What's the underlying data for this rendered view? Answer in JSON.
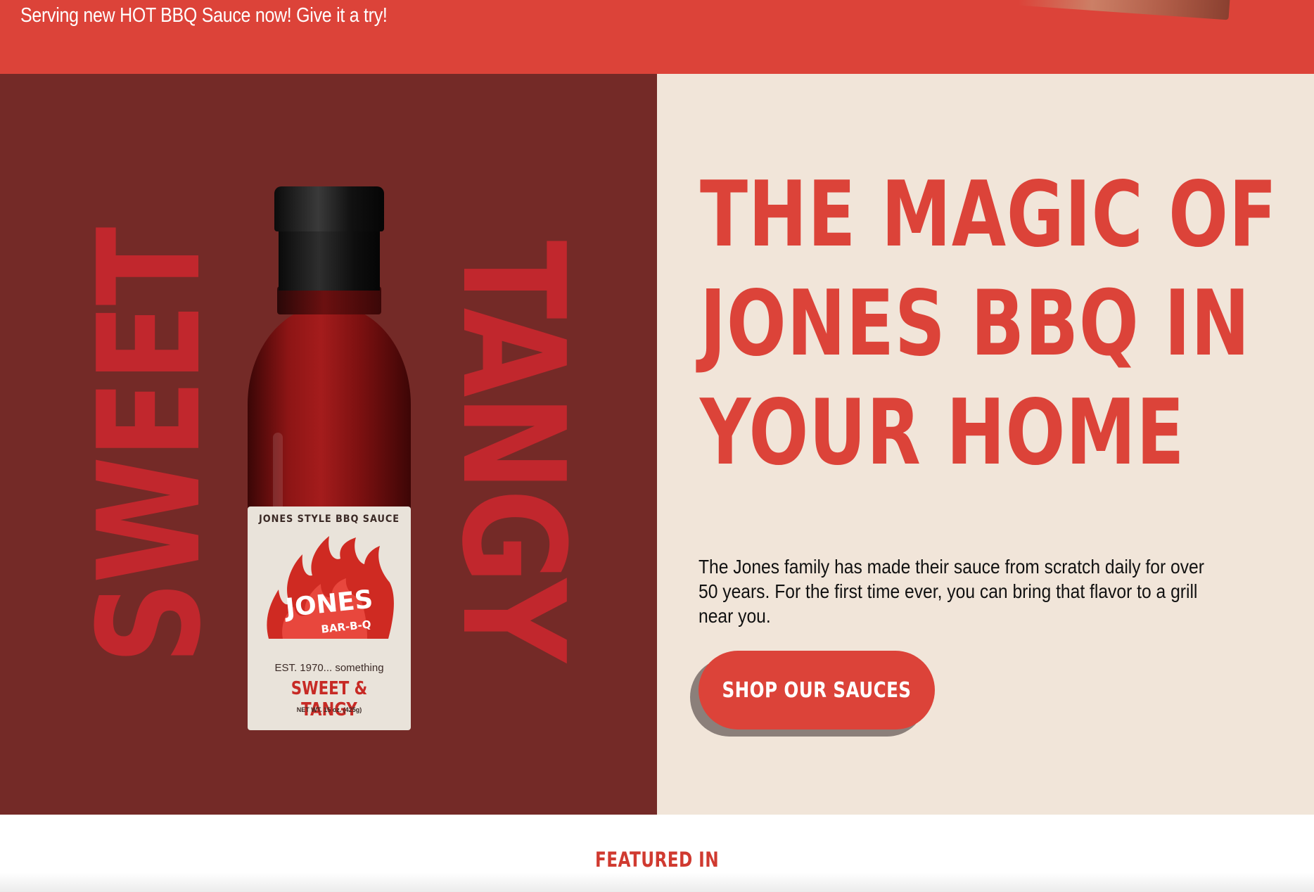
{
  "announcement": {
    "text": "Serving new HOT BBQ Sauce now!  Give it a try!"
  },
  "hero": {
    "side_words": {
      "left": "SWEET",
      "right": "TANGY"
    },
    "bottle_label": {
      "top_text": "JONES STYLE BBQ SAUCE",
      "brand": "JONES",
      "brand_sub": "BAR-B-Q",
      "established": "EST. 1970... something",
      "flavor": "SWEET & TANGY",
      "net_weight": "NET WT. 15 oz. (425g)"
    },
    "headline_lines": [
      "THE MAGIC OF",
      "JONES BBQ IN",
      "YOUR HOME"
    ],
    "body": "The Jones family has made their sauce from scratch daily for over 50 years. For the first time ever, you can bring that flavor to a grill near you.",
    "cta_label": "SHOP OUR SAUCES"
  },
  "featured": {
    "title": "FEATURED IN"
  },
  "colors": {
    "brand_red": "#dc4339",
    "left_panel": "#742a27",
    "side_word_red": "#c1272d",
    "right_panel": "#f1e5d9",
    "body_text": "#111111",
    "button_shadow": "#8b7f7a"
  },
  "icons": {
    "label_graphic": "flame-icon"
  }
}
